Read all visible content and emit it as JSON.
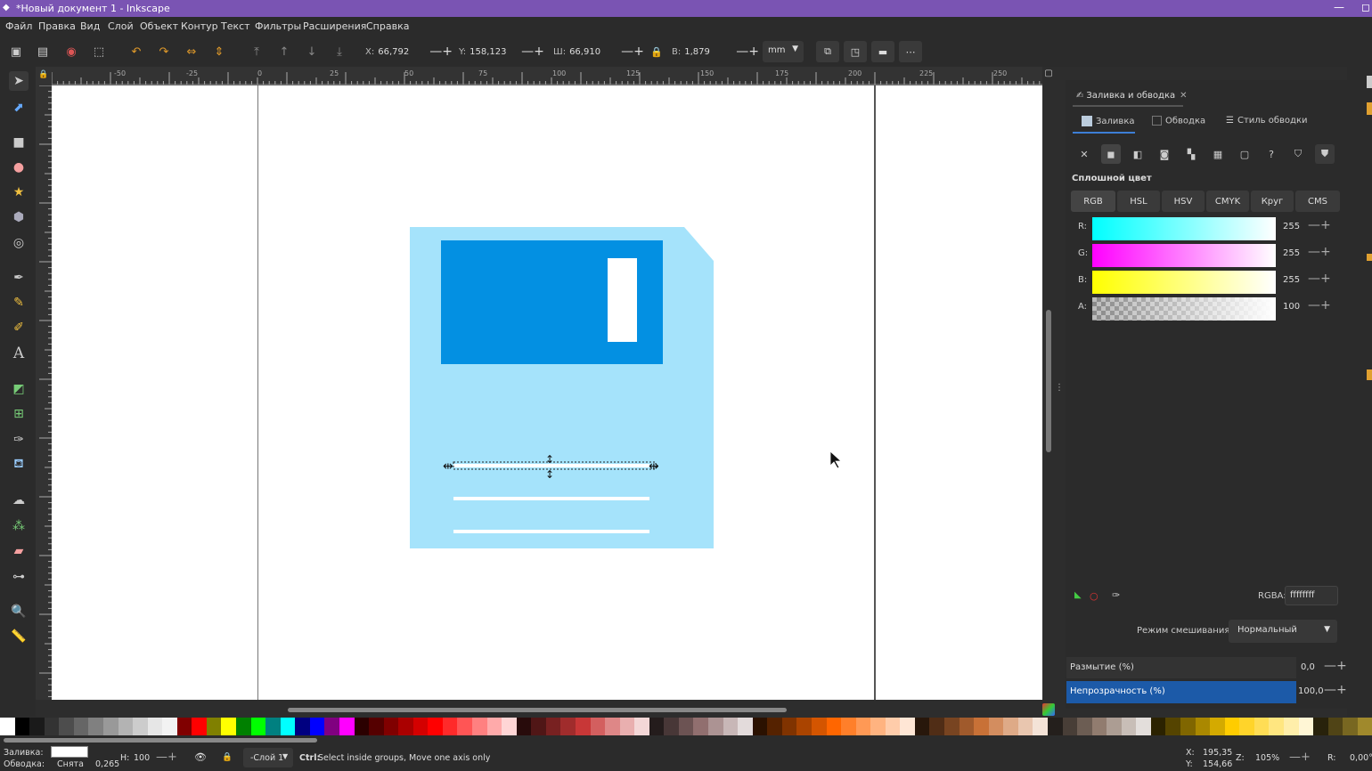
{
  "title": "*Новый документ 1 - Inkscape",
  "window_buttons": {
    "minimize": "—",
    "maximize": "◻"
  },
  "menu": [
    "Файл",
    "Правка",
    "Вид",
    "Слой",
    "Объект",
    "Контур",
    "Текст",
    "Фильтры",
    "Расширения",
    "Справка"
  ],
  "toolbar": {
    "x_label": "X:",
    "x_value": "66,792",
    "y_label": "Y:",
    "y_value": "158,123",
    "w_label": "Ш:",
    "w_value": "66,910",
    "h_label": "В:",
    "h_value": "1,879",
    "unit": "mm"
  },
  "ruler_ticks": [
    "-50",
    "-25",
    "0",
    "25",
    "50",
    "75",
    "100",
    "125",
    "150",
    "175",
    "200",
    "225",
    "250"
  ],
  "panel": {
    "tab_label": "Заливка и обводка",
    "subtabs": [
      "Заливка",
      "Обводка",
      "Стиль обводки"
    ],
    "section_title": "Сплошной цвет",
    "modes": [
      "RGB",
      "HSL",
      "HSV",
      "CMYK",
      "Круг",
      "CMS"
    ],
    "sliders": [
      {
        "label": "R:",
        "value": "255"
      },
      {
        "label": "G:",
        "value": "255"
      },
      {
        "label": "B:",
        "value": "255"
      },
      {
        "label": "A:",
        "value": "100"
      }
    ],
    "rgba_label": "RGBA:",
    "rgba_value": "ffffffff",
    "blend_label": "Режим смешивания:",
    "blend_value": "Нормальный",
    "blur_label": "Размытие (%)",
    "blur_value": "0,0",
    "opacity_label": "Непрозрачность (%)",
    "opacity_value": "100,0"
  },
  "status": {
    "fill_label": "Заливка:",
    "stroke_label": "Обводка:",
    "stroke_value": "Снята",
    "stroke_width": "0,265",
    "h_label": "Н:",
    "h_value": "100",
    "layer": "-Слой 1",
    "message_key": "Ctrl:",
    "message": "Select inside groups, Move one axis only",
    "cursor_x_label": "X:",
    "cursor_x": "195,35",
    "cursor_y_label": "Y:",
    "cursor_y": "154,66",
    "zoom_label": "Z:",
    "zoom": "105%",
    "rotate_label": "R:",
    "rotate": "0,00°"
  },
  "colors": {
    "titlebar": "#7a54b3",
    "disk_light": "#a5e3fb",
    "disk_dark": "#0390e2",
    "accent": "#1c5aa8"
  }
}
